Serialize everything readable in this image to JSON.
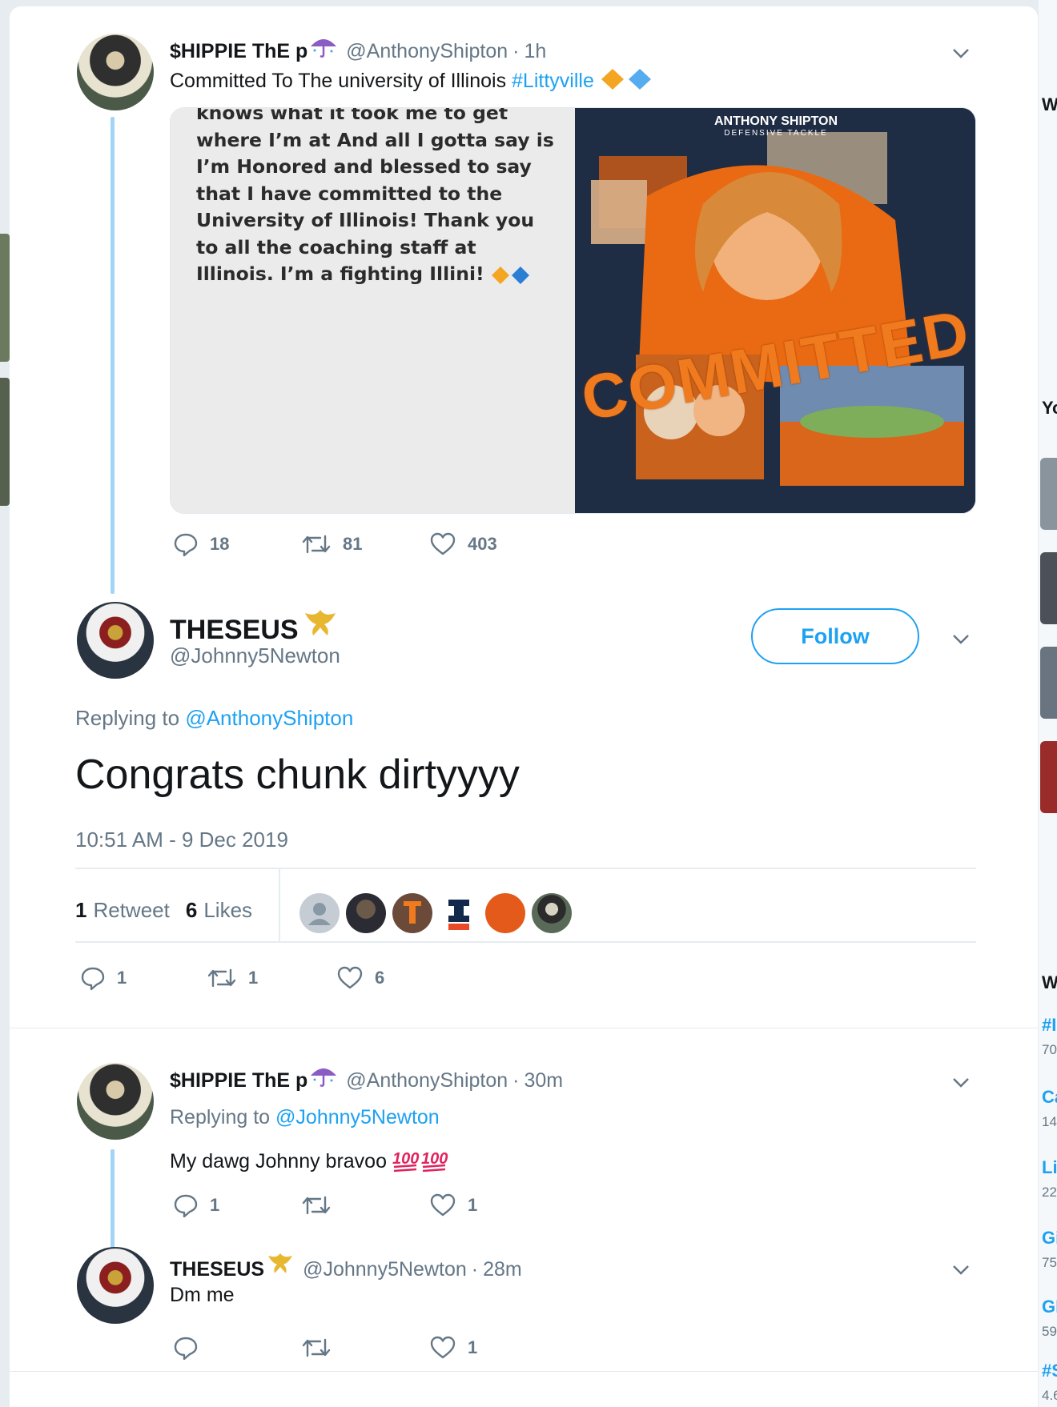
{
  "colors": {
    "accent": "#1da1f2",
    "thread_line": "#a4d4f5",
    "text_primary": "#14171a",
    "text_secondary": "#657786"
  },
  "background": {
    "right_fragments": [
      "W",
      "Yo",
      "W",
      "#I",
      "70",
      "Ca",
      "14",
      "Li",
      "22",
      "Gi",
      "75",
      "Gl",
      "59",
      "#S",
      "4.6"
    ]
  },
  "tweet1": {
    "display_name": "$HIPPIE ThE p",
    "emoji": "umbrella-emoji",
    "handle": "@AnthonyShipton",
    "time": "1h",
    "text": "Committed To The university of Illinois ",
    "hashtag": "#Littyville",
    "media_text_lines": [
      "knows what it took me to get",
      "where I’m at And all I gotta say is",
      "I’m Honored and blessed to say",
      "that I have committed to the",
      "University of Illinois!  Thank you",
      "to all the coaching staff at",
      "Illinois. I’m a fighting Illini! "
    ],
    "poster": {
      "name": "ANTHONY SHIPTON",
      "position": "DEFENSIVE TACKLE",
      "headline": "COMMITTED"
    },
    "replies": "18",
    "retweets": "81",
    "likes": "403"
  },
  "main_tweet": {
    "display_name": "THESEUS",
    "emoji": "crest-emoji",
    "handle": "@Johnny5Newton",
    "follow_label": "Follow",
    "replying_prefix": "Replying to ",
    "replying_to": "@AnthonyShipton",
    "text": "Congrats chunk dirtyyyy",
    "timestamp": "10:51 AM - 9 Dec 2019",
    "retweet_count": "1",
    "retweet_label": "Retweet",
    "like_count": "6",
    "like_label": "Likes",
    "replies": "1",
    "retweets": "1",
    "likes": "6",
    "likers": [
      "default-avatar",
      "liker-avatar-2",
      "liker-avatar-3",
      "liker-avatar-4",
      "liker-avatar-5",
      "liker-avatar-6"
    ]
  },
  "reply1": {
    "display_name": "$HIPPIE ThE p",
    "handle": "@AnthonyShipton",
    "time": "30m",
    "replying_prefix": "Replying to ",
    "replying_to": "@Johnny5Newton",
    "text": "My dawg Johnny bravoo",
    "emoji": "hundred-points-emoji",
    "replies": "1",
    "retweets": "",
    "likes": "1"
  },
  "reply2": {
    "display_name": "THESEUS",
    "handle": "@Johnny5Newton",
    "time": "28m",
    "text": "Dm me",
    "replies": "",
    "retweets": "",
    "likes": "1"
  }
}
